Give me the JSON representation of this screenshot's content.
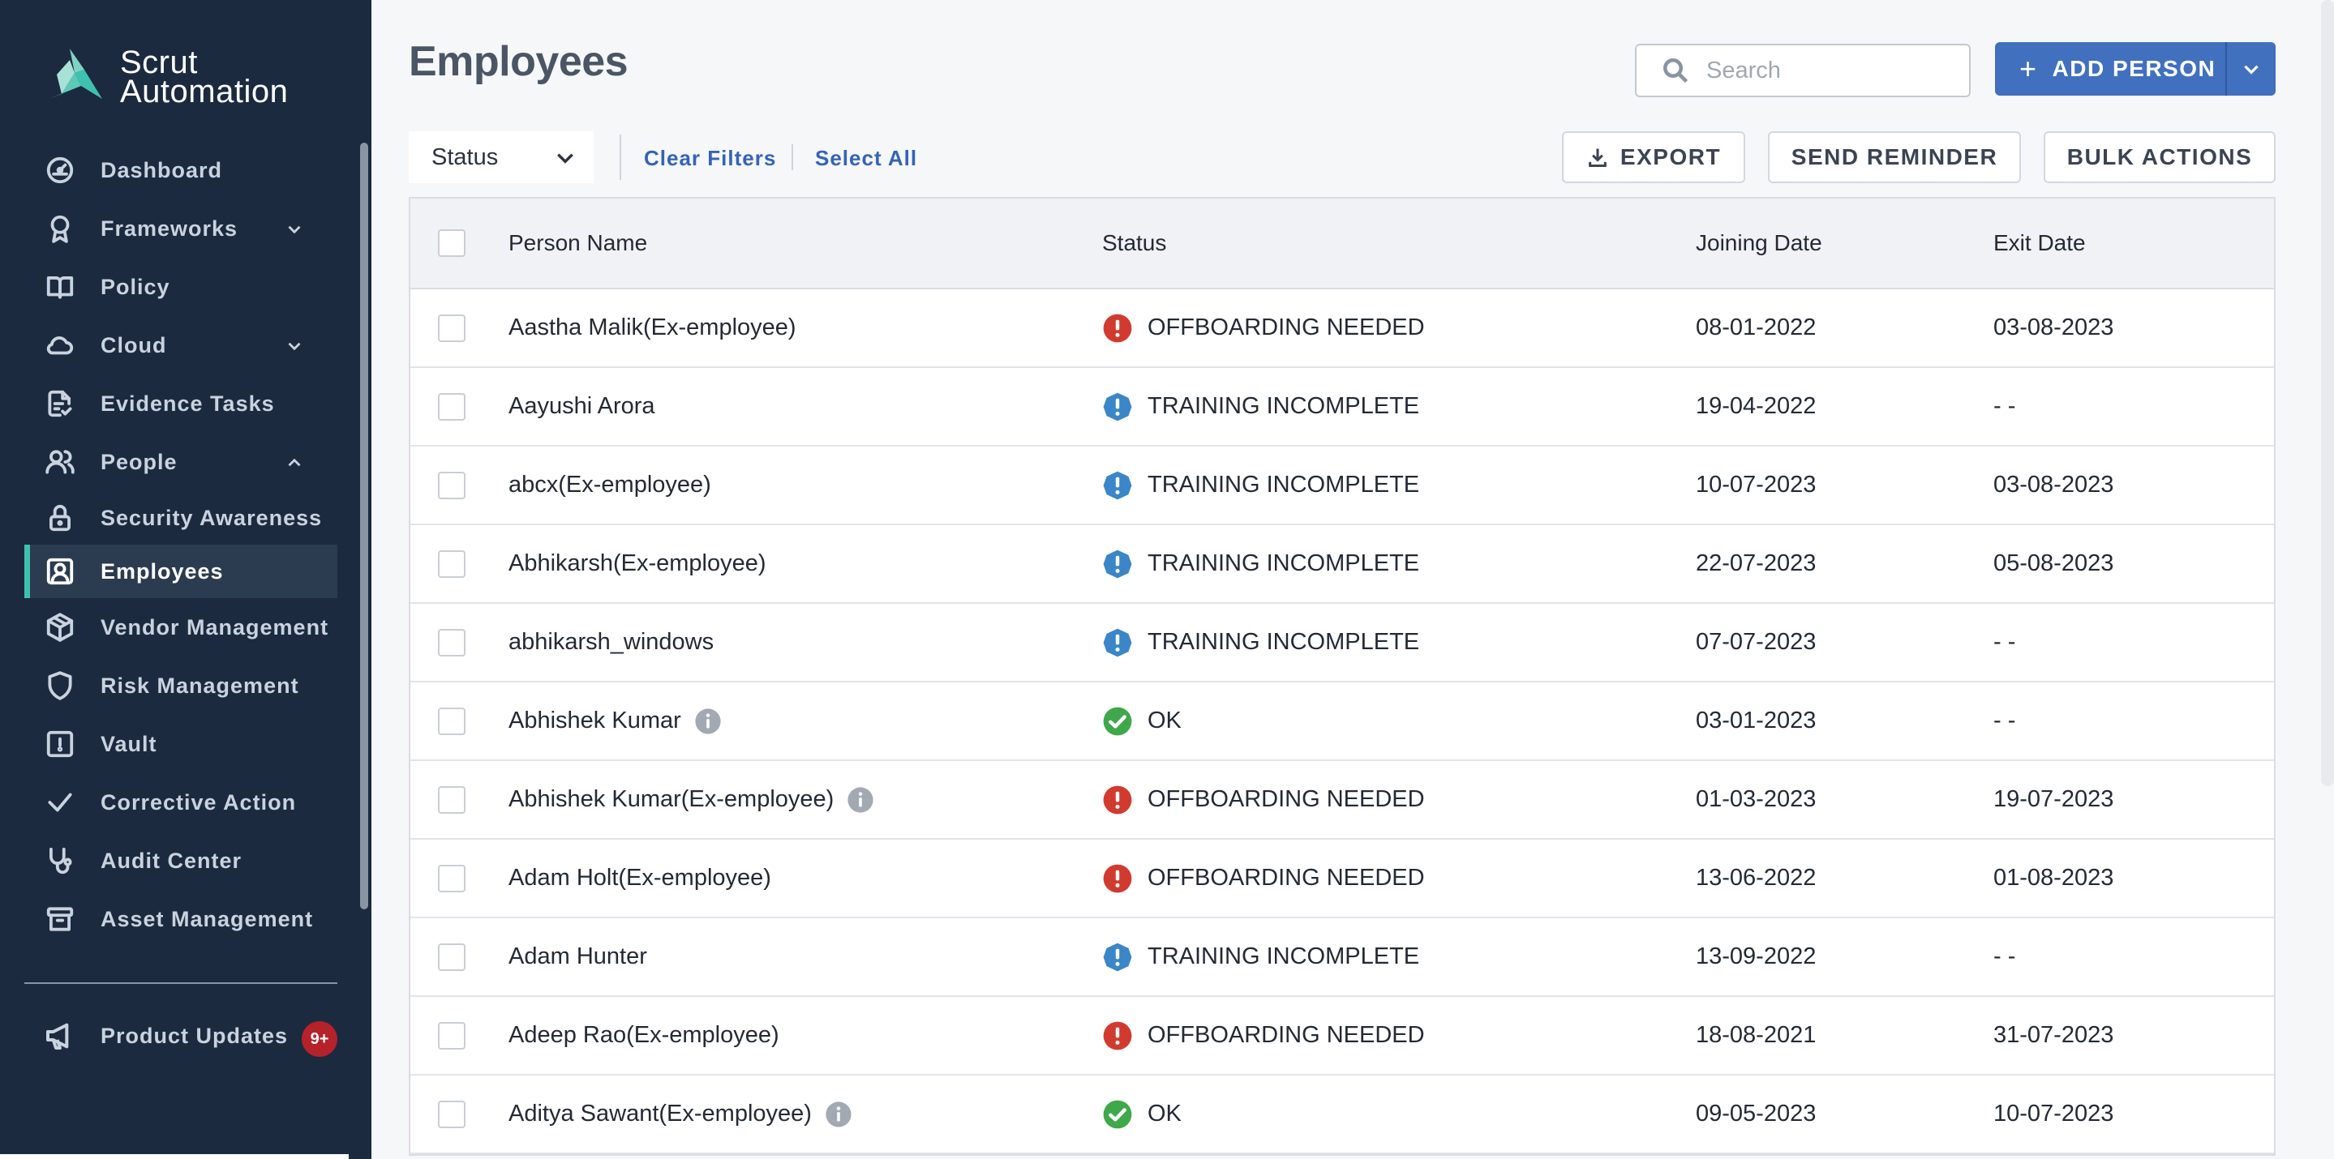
{
  "brand": {
    "line1": "Scrut",
    "line2": "Automation"
  },
  "sidebar": {
    "items": [
      {
        "label": "Dashboard",
        "icon": "dashboard-icon"
      },
      {
        "label": "Frameworks",
        "icon": "award-icon",
        "expandable": "collapsed"
      },
      {
        "label": "Policy",
        "icon": "book-icon"
      },
      {
        "label": "Cloud",
        "icon": "cloud-icon",
        "expandable": "collapsed"
      },
      {
        "label": "Evidence Tasks",
        "icon": "document-check-icon"
      },
      {
        "label": "People",
        "icon": "people-icon",
        "expandable": "expanded"
      },
      {
        "label": "Security Awareness",
        "icon": "lock-icon",
        "sub": true
      },
      {
        "label": "Employees",
        "icon": "user-badge-icon",
        "sub": true,
        "active": true
      },
      {
        "label": "Vendor Management",
        "icon": "box-icon"
      },
      {
        "label": "Risk Management",
        "icon": "shield-icon"
      },
      {
        "label": "Vault",
        "icon": "vault-icon"
      },
      {
        "label": "Corrective Action",
        "icon": "check-icon"
      },
      {
        "label": "Audit Center",
        "icon": "stethoscope-icon"
      },
      {
        "label": "Asset Management",
        "icon": "archive-icon"
      }
    ],
    "product_updates": {
      "label": "Product Updates",
      "badge": "9+"
    }
  },
  "header": {
    "title": "Employees",
    "search_placeholder": "Search",
    "add_person_label": "ADD PERSON"
  },
  "toolbar": {
    "status_filter": "Status",
    "clear_filters": "Clear Filters",
    "select_all": "Select All",
    "export": "EXPORT",
    "send_reminder": "SEND REMINDER",
    "bulk_actions": "BULK ACTIONS"
  },
  "table": {
    "columns": [
      "Person Name",
      "Status",
      "Joining Date",
      "Exit Date"
    ],
    "rows": [
      {
        "name": "Aastha Malik(Ex-employee)",
        "status": "OFFBOARDING NEEDED",
        "kind": "error",
        "joining": "08-01-2022",
        "exit": "03-08-2023",
        "info": false
      },
      {
        "name": "Aayushi Arora",
        "status": "TRAINING INCOMPLETE",
        "kind": "warning",
        "joining": "19-04-2022",
        "exit": "- -",
        "info": false
      },
      {
        "name": "abcx(Ex-employee)",
        "status": "TRAINING INCOMPLETE",
        "kind": "warning",
        "joining": "10-07-2023",
        "exit": "03-08-2023",
        "info": false
      },
      {
        "name": "Abhikarsh(Ex-employee)",
        "status": "TRAINING INCOMPLETE",
        "kind": "warning",
        "joining": "22-07-2023",
        "exit": "05-08-2023",
        "info": false
      },
      {
        "name": "abhikarsh_windows",
        "status": "TRAINING INCOMPLETE",
        "kind": "warning",
        "joining": "07-07-2023",
        "exit": "- -",
        "info": false
      },
      {
        "name": "Abhishek Kumar",
        "status": "OK",
        "kind": "ok",
        "joining": "03-01-2023",
        "exit": "- -",
        "info": true
      },
      {
        "name": "Abhishek Kumar(Ex-employee)",
        "status": "OFFBOARDING NEEDED",
        "kind": "error",
        "joining": "01-03-2023",
        "exit": "19-07-2023",
        "info": true
      },
      {
        "name": "Adam Holt(Ex-employee)",
        "status": "OFFBOARDING NEEDED",
        "kind": "error",
        "joining": "13-06-2022",
        "exit": "01-08-2023",
        "info": false
      },
      {
        "name": "Adam Hunter",
        "status": "TRAINING INCOMPLETE",
        "kind": "warning",
        "joining": "13-09-2022",
        "exit": "- -",
        "info": false
      },
      {
        "name": "Adeep Rao(Ex-employee)",
        "status": "OFFBOARDING NEEDED",
        "kind": "error",
        "joining": "18-08-2021",
        "exit": "31-07-2023",
        "info": false
      },
      {
        "name": "Aditya Sawant(Ex-employee)",
        "status": "OK",
        "kind": "ok",
        "joining": "09-05-2023",
        "exit": "10-07-2023",
        "info": true
      }
    ]
  },
  "colors": {
    "sidebar_bg": "#1b2a3f",
    "accent": "#4170bf",
    "active_marker": "#3fc1b0",
    "status_error": "#d13b2f",
    "status_warning": "#3a86c8",
    "status_ok": "#3fa84a",
    "badge": "#b5222a"
  }
}
